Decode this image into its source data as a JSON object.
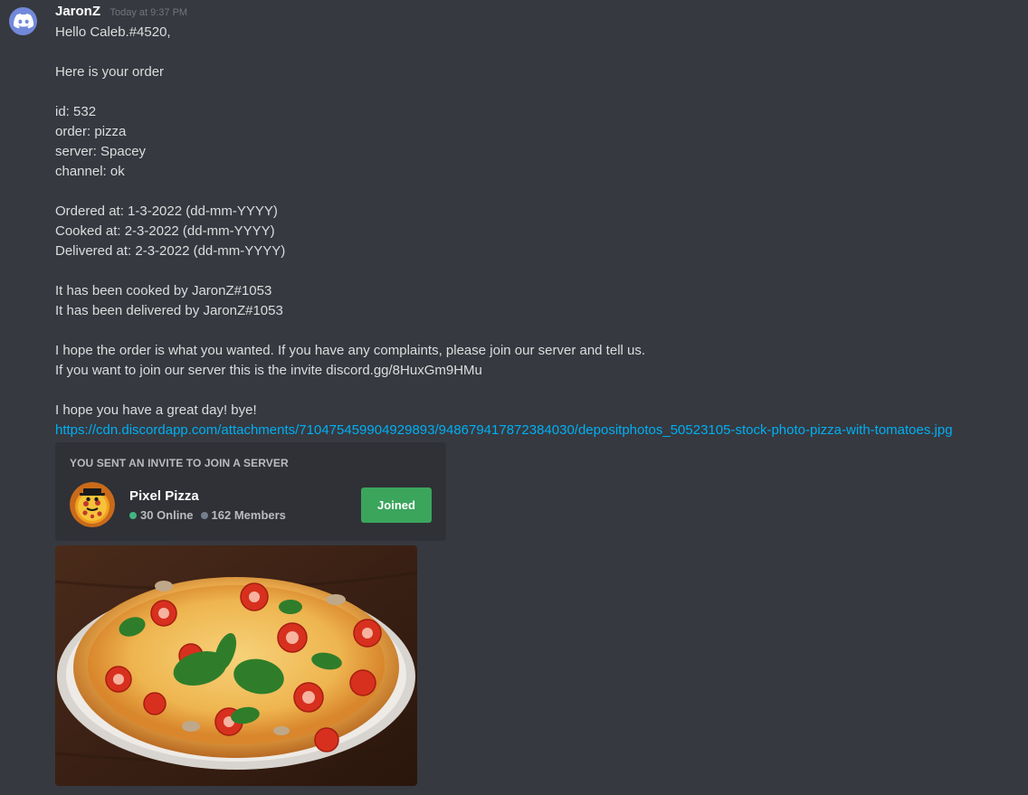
{
  "message": {
    "author": "JaronZ",
    "timestamp": "Today at 9:37 PM",
    "avatar_icon": "discord-logo-icon",
    "lines": [
      "Hello Caleb.#4520,",
      "",
      "Here is your order",
      "",
      "id: 532",
      "order: pizza",
      "server: Spacey",
      "channel: ok",
      "",
      "Ordered at: 1-3-2022 (dd-mm-YYYY)",
      "Cooked at: 2-3-2022 (dd-mm-YYYY)",
      "Delivered at: 2-3-2022 (dd-mm-YYYY)",
      "",
      "It has been cooked by JaronZ#1053",
      "It has been delivered by JaronZ#1053",
      "",
      "I hope the order is what you wanted. If you have any complaints, please join our server and tell us.",
      "If you want to join our server this is the invite discord.gg/8HuxGm9HMu",
      "",
      "I hope you have a great day! bye!"
    ],
    "link": "https://cdn.discordapp.com/attachments/710475459904929893/948679417872384030/depositphotos_50523105-stock-photo-pizza-with-tomatoes.jpg"
  },
  "invite": {
    "title": "YOU SENT AN INVITE TO JOIN A SERVER",
    "server_name": "Pixel Pizza",
    "online": "30 Online",
    "members": "162 Members",
    "button_label": "Joined",
    "server_icon": "pixel-pizza-server-icon"
  },
  "attachment": {
    "image_icon": "pizza-photo"
  },
  "colors": {
    "background": "#36393f",
    "link": "#00aff4",
    "joined_button": "#3ba55c",
    "online_dot": "#43b581",
    "invite_bg": "#2f3136"
  }
}
